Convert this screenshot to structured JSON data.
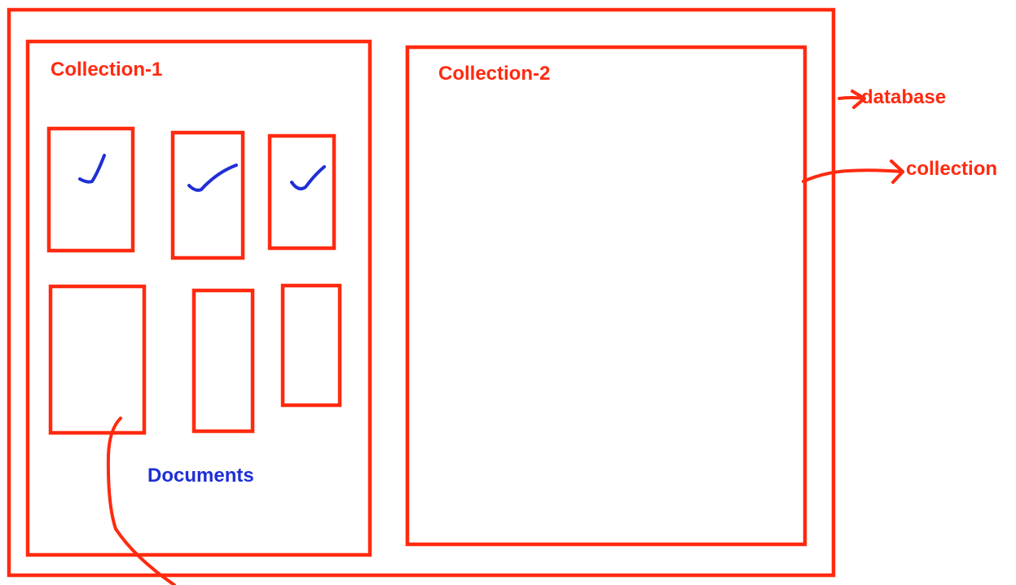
{
  "labels": {
    "collection_1": "Collection-1",
    "collection_2": "Collection-2",
    "database": "database",
    "collection": "collection",
    "documents": "Documents"
  },
  "colors": {
    "outline": "#ff2a10",
    "annotation": "#1f2fd6",
    "background": "#ffffff"
  },
  "icons": {
    "document_checked": "check-mark-icon"
  }
}
